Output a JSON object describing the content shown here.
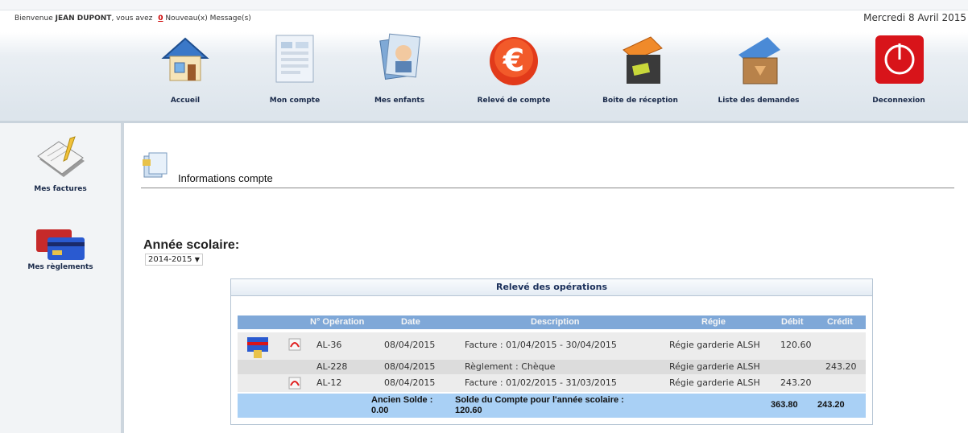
{
  "header": {
    "welcome_prefix": "Bienvenue",
    "user_name": "JEAN DUPONT",
    "welcome_mid": ", vous avez",
    "message_count": "0",
    "message_text": "Nouveau(x) Message(s)",
    "date": "Mercredi 8 Avril 2015"
  },
  "nav": [
    {
      "label": "Accueil",
      "icon": "home-icon"
    },
    {
      "label": "Mon compte",
      "icon": "account-icon"
    },
    {
      "label": "Mes enfants",
      "icon": "children-icon"
    },
    {
      "label": "Relevé de compte",
      "icon": "euro-icon"
    },
    {
      "label": "Boite de réception",
      "icon": "inbox-icon"
    },
    {
      "label": "Liste des demandes",
      "icon": "requests-icon"
    },
    {
      "label": "Deconnexion",
      "icon": "power-icon"
    }
  ],
  "sidebar": {
    "items": [
      {
        "label": "Mes factures",
        "icon": "invoices-icon"
      },
      {
        "label": "Mes règlements",
        "icon": "payments-icon"
      }
    ]
  },
  "main": {
    "title": "Informations compte",
    "year_label": "Année scolaire:",
    "year_value": "2014-2015"
  },
  "statement": {
    "title": "Relevé des opérations",
    "columns": [
      "N° Opération",
      "Date",
      "Description",
      "Régie",
      "Débit",
      "Crédit"
    ],
    "rows": [
      {
        "op": "AL-36",
        "date": "08/04/2015",
        "desc": "Facture : 01/04/2015 - 30/04/2015",
        "regie": "Régie garderie ALSH",
        "debit": "120.60",
        "credit": ""
      },
      {
        "op": "AL-228",
        "date": "08/04/2015",
        "desc": "Règlement : Chèque",
        "regie": "Régie garderie ALSH",
        "debit": "",
        "credit": "243.20"
      },
      {
        "op": "AL-12",
        "date": "08/04/2015",
        "desc": "Facture : 01/02/2015 - 31/03/2015",
        "regie": "Régie garderie ALSH",
        "debit": "243.20",
        "credit": ""
      }
    ],
    "total": {
      "old_balance_label": "Ancien Solde :",
      "old_balance_value": "0.00",
      "balance_label": "Solde du Compte pour l'année scolaire :",
      "balance_value": "120.60",
      "debit_total": "363.80",
      "credit_total": "243.20"
    }
  }
}
